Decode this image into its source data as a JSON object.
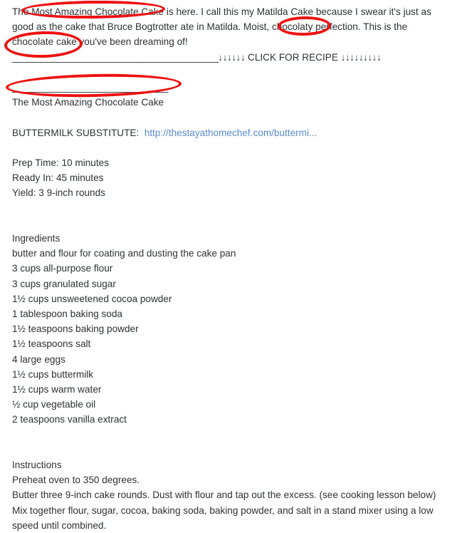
{
  "page": {
    "background_color": "#ffffff",
    "text_color": "#2d3134",
    "link_color": "#5a8bd0",
    "annotation_color": "#ee1111"
  },
  "intro": {
    "line1": "The Most Amazing Chocolate Cake is here. I call this my Matilda Cake because I swear it's just as",
    "line2": "good as the cake that Bruce Bogtrotter ate in Matilda. Moist, chocolaty perfection. This is the",
    "line3": "chocolate cake you've been dreaming of!"
  },
  "divider": {
    "rule_long": "_________________________________________",
    "arrows_left": "↓↓↓↓↓↓",
    "click_label": "CLICK FOR RECIPE",
    "arrows_right": "↓↓↓↓↓↓↓↓↓",
    "rule_short": "_______________________________"
  },
  "recipe_title": "The Most Amazing Chocolate Cake",
  "buttermilk": {
    "label": "BUTTERMILK SUBSTITUTE:",
    "url_text": "http://thestayathomechef.com/buttermi..."
  },
  "times": {
    "prep": "Prep Time: 10 minutes",
    "ready": "Ready In: 45 minutes",
    "yield": "Yield: 3 9-inch rounds"
  },
  "ingredients": {
    "heading": "Ingredients",
    "items": [
      "butter and flour for coating and dusting the cake pan",
      "3 cups all-purpose flour",
      "3 cups granulated sugar",
      "1½ cups unsweetened cocoa powder",
      "1 tablespoon baking soda",
      "1½ teaspoons baking powder",
      "1½ teaspoons salt",
      "4 large eggs",
      "1½ cups buttermilk",
      "1½ cups warm water",
      "½ cup vegetable oil",
      "2 teaspoons vanilla extract"
    ]
  },
  "instructions": {
    "heading": "Instructions",
    "steps": [
      "Preheat oven to 350 degrees.",
      "Butter three 9-inch cake rounds. Dust with flour and tap out the excess. (see cooking lesson below)",
      "Mix together flour, sugar, cocoa, baking soda, baking powder, and salt in a stand mixer using a low speed until combined."
    ]
  },
  "annotations": [
    {
      "name": "circle-most-amazing-chocolate-cake",
      "target": "Most Amazing Chocolate Cake"
    },
    {
      "name": "circle-chocolaty",
      "target": "chocolaty"
    },
    {
      "name": "circle-chocolate-cake",
      "target": "chocolate cake"
    },
    {
      "name": "circle-recipe-title",
      "target": "The Most Amazing Chocolate Cake"
    }
  ]
}
